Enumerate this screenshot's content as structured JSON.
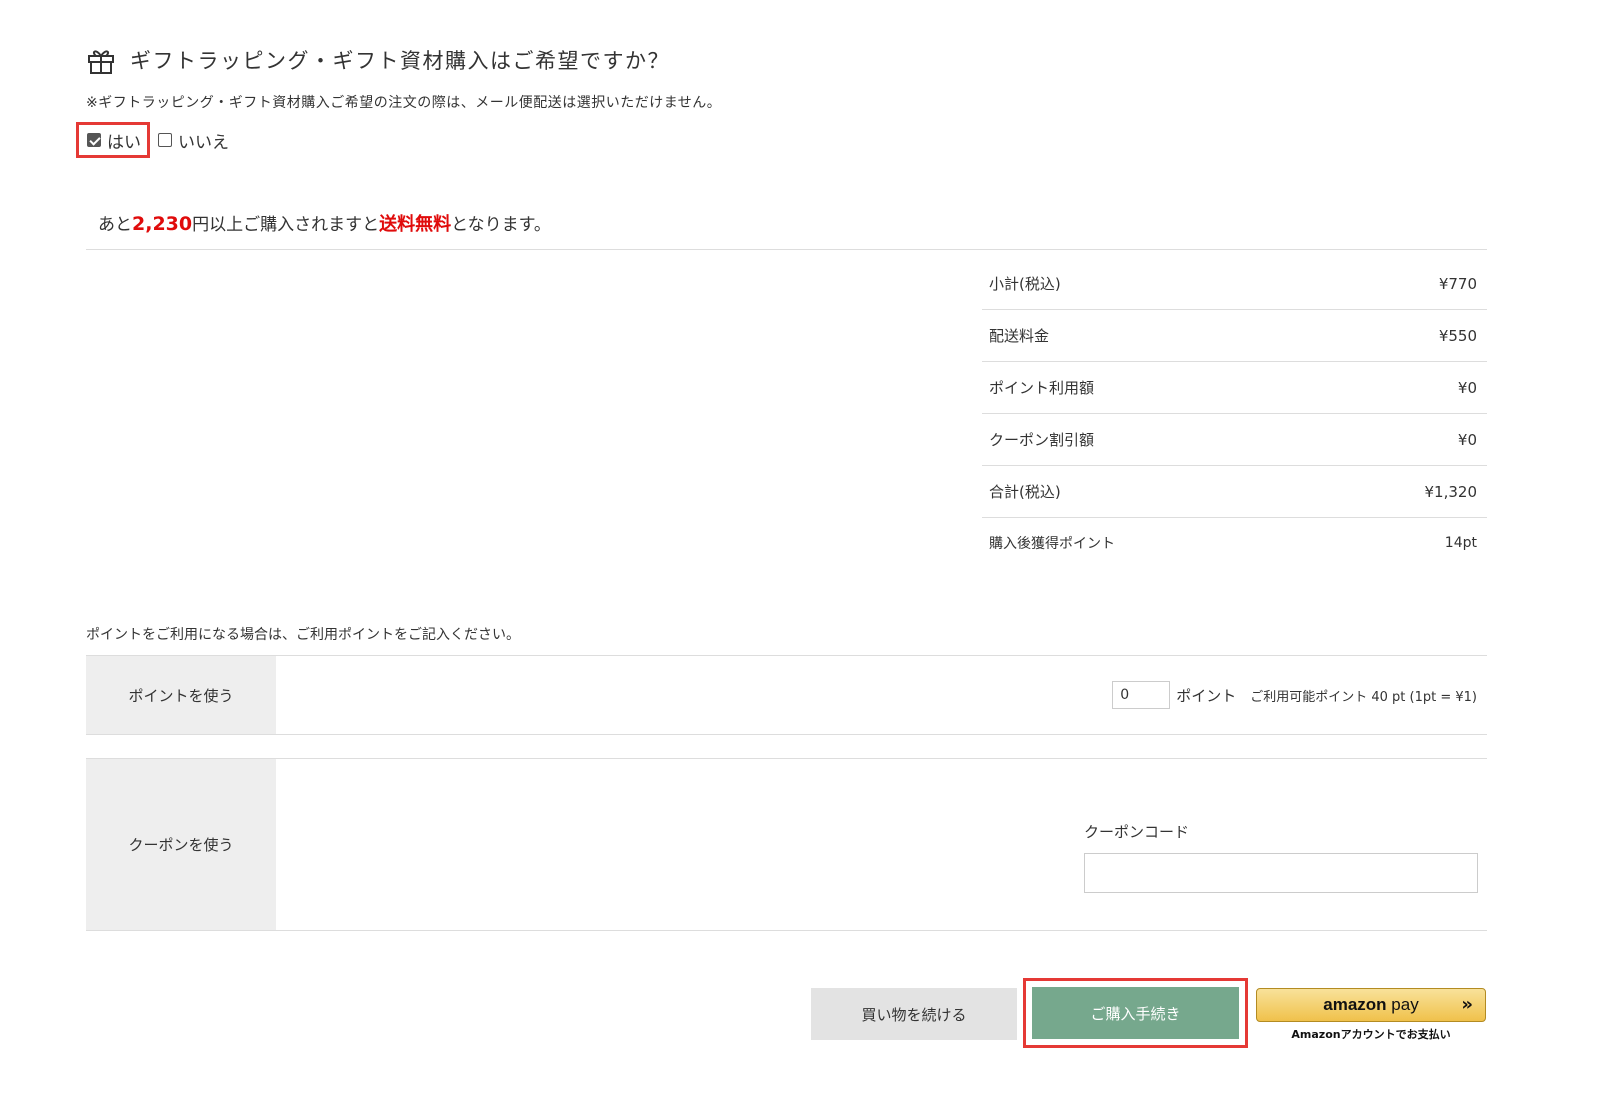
{
  "gift": {
    "title": "ギフトラッピング・ギフト資材購入はご希望ですか？",
    "note": "※ギフトラッピング・ギフト資材購入ご希望の注文の際は、メール便配送は選択いただけません。",
    "option_yes": "はい",
    "option_no": "いいえ",
    "selected": "yes",
    "icon": "gift-icon"
  },
  "free_shipping": {
    "prefix": "あと",
    "amount": "2,230",
    "middle": "円以上ご購入されますと",
    "highlight": "送料無料",
    "suffix": "となります。"
  },
  "summary": [
    {
      "label": "小計(税込)",
      "value": "¥770"
    },
    {
      "label": "配送料金",
      "value": "¥550"
    },
    {
      "label": "ポイント利用額",
      "value": "¥0"
    },
    {
      "label": "クーポン割引額",
      "value": "¥0"
    },
    {
      "label": "合計(税込)",
      "value": "¥1,320"
    },
    {
      "label": "購入後獲得ポイント",
      "value": "14pt"
    }
  ],
  "points": {
    "note": "ポイントをご利用になる場合は、ご利用ポイントをご記入ください。",
    "header": "ポイントを使う",
    "value": "0",
    "unit": "ポイント",
    "available": "ご利用可能ポイント 40 pt (1pt = ¥1)"
  },
  "coupon": {
    "header": "クーポンを使う",
    "label": "クーポンコード",
    "value": ""
  },
  "actions": {
    "continue": "買い物を続ける",
    "checkout": "ご購入手続き",
    "amazon_pay_brand": "amazon",
    "amazon_pay_word": "pay",
    "amazon_pay_note": "Amazonアカウントでお支払い"
  },
  "colors": {
    "accent_red": "#e00b0b",
    "highlight_border": "#e53935",
    "checkout_green": "#76a88d",
    "amazon_gold": "#f0c14b"
  }
}
